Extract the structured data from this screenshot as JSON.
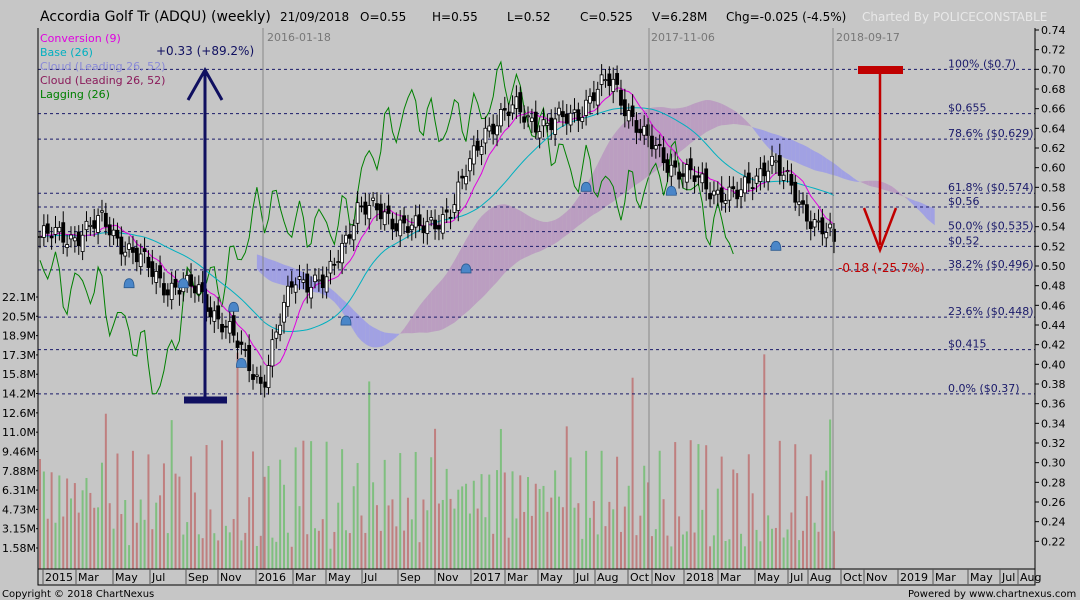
{
  "header": {
    "title": "Accordia Golf Tr (ADQU) (weekly)",
    "date": "21/09/2018",
    "open": "O=0.55",
    "high": "H=0.55",
    "low": "L=0.52",
    "close": "C=0.525",
    "volume": "V=6.28M",
    "change": "Chg=-0.025 (-4.5%)",
    "charted_by": "Charted By POLICECONSTABLE"
  },
  "legend": [
    {
      "label": "Conversion (9)",
      "color": "#e000e0"
    },
    {
      "label": "Base (26)",
      "color": "#00b0c0"
    },
    {
      "label": "Cloud (Leading 26, 52)",
      "color": "#8a8ad8"
    },
    {
      "label": "Cloud (Leading 26, 52)",
      "color": "#8a1a5a"
    },
    {
      "label": "Lagging (26)",
      "color": "#008000"
    }
  ],
  "date_markers": [
    "2016-01-18",
    "2017-11-06",
    "2018-09-17"
  ],
  "annotations": {
    "up_move": "+0.33 (+89.2%)",
    "down_move": "-0.18 (-25.7%)"
  },
  "fib_levels": [
    {
      "label": "100%  ($0.7)",
      "value": 0.7
    },
    {
      "label": "$0.655",
      "value": 0.655
    },
    {
      "label": "78.6%  ($0.629)",
      "value": 0.629
    },
    {
      "label": "61.8%  ($0.574)",
      "value": 0.574
    },
    {
      "label": "$0.56",
      "value": 0.56
    },
    {
      "label": "50.0%  ($0.535)",
      "value": 0.535
    },
    {
      "label": "$0.52",
      "value": 0.52
    },
    {
      "label": "38.2%  ($0.496)",
      "value": 0.496
    },
    {
      "label": "23.6%  ($0.448)",
      "value": 0.448
    },
    {
      "label": "$0.415",
      "value": 0.415
    },
    {
      "label": "0.0%  ($0.37)",
      "value": 0.37
    }
  ],
  "volume_axis": [
    "22.1M",
    "20.5M",
    "18.9M",
    "17.3M",
    "15.8M",
    "14.2M",
    "12.6M",
    "11.0M",
    "9.46M",
    "7.88M",
    "6.31M",
    "4.73M",
    "3.15M",
    "1.58M"
  ],
  "x_axis": [
    "2015",
    "Mar",
    "May",
    "Jul",
    "Sep",
    "Nov",
    "2016",
    "Mar",
    "May",
    "Jul",
    "Sep",
    "Nov",
    "2017",
    "Mar",
    "May",
    "Jul",
    "Aug",
    "Oct",
    "Nov",
    "2018",
    "Mar",
    "May",
    "Jul",
    "Aug",
    "Oct",
    "Nov",
    "2019",
    "Mar",
    "May",
    "Jul",
    "Aug"
  ],
  "footer": {
    "copyright": "Copyright © 2018 ChartNexus",
    "powered": "Powered by www.chartnexus.com"
  },
  "colors": {
    "background": "#c6c6c6",
    "candle": "#000000",
    "volume_up": "#7fbf7f",
    "volume_down": "#bf7f7f",
    "up_arrow": "#101060",
    "down_arrow": "#c00000"
  },
  "chart_data": {
    "type": "candlestick",
    "title": "Accordia Golf Tr (ADQU) (weekly)",
    "ylim": [
      0.2,
      0.74
    ],
    "y_ticks": [
      0.74,
      0.72,
      0.7,
      0.68,
      0.66,
      0.64,
      0.62,
      0.6,
      0.58,
      0.56,
      0.54,
      0.52,
      0.5,
      0.48,
      0.46,
      0.44,
      0.42,
      0.4,
      0.38,
      0.36,
      0.34,
      0.32,
      0.3,
      0.28,
      0.26,
      0.24,
      0.22
    ],
    "close_path_anchors": [
      [
        "2015-01",
        0.53
      ],
      [
        "2015-03",
        0.53
      ],
      [
        "2015-05",
        0.545
      ],
      [
        "2015-06",
        0.51
      ],
      [
        "2015-08",
        0.48
      ],
      [
        "2015-10",
        0.475
      ],
      [
        "2015-11",
        0.43
      ],
      [
        "2016-01",
        0.38
      ],
      [
        "2016-03",
        0.49
      ],
      [
        "2016-05",
        0.48
      ],
      [
        "2016-07",
        0.56
      ],
      [
        "2016-09",
        0.55
      ],
      [
        "2016-11",
        0.535
      ],
      [
        "2017-01",
        0.56
      ],
      [
        "2017-03",
        0.64
      ],
      [
        "2017-05",
        0.66
      ],
      [
        "2017-07",
        0.64
      ],
      [
        "2017-09",
        0.66
      ],
      [
        "2017-11",
        0.69
      ],
      [
        "2017-12",
        0.63
      ],
      [
        "2018-02",
        0.6
      ],
      [
        "2018-04",
        0.58
      ],
      [
        "2018-05",
        0.57
      ],
      [
        "2018-06",
        0.61
      ],
      [
        "2018-08",
        0.56
      ],
      [
        "2018-09",
        0.525
      ]
    ],
    "last_bar": {
      "date": "2018-09-21",
      "open": 0.55,
      "high": 0.55,
      "low": 0.52,
      "close": 0.525,
      "volume": "6.28M"
    }
  }
}
